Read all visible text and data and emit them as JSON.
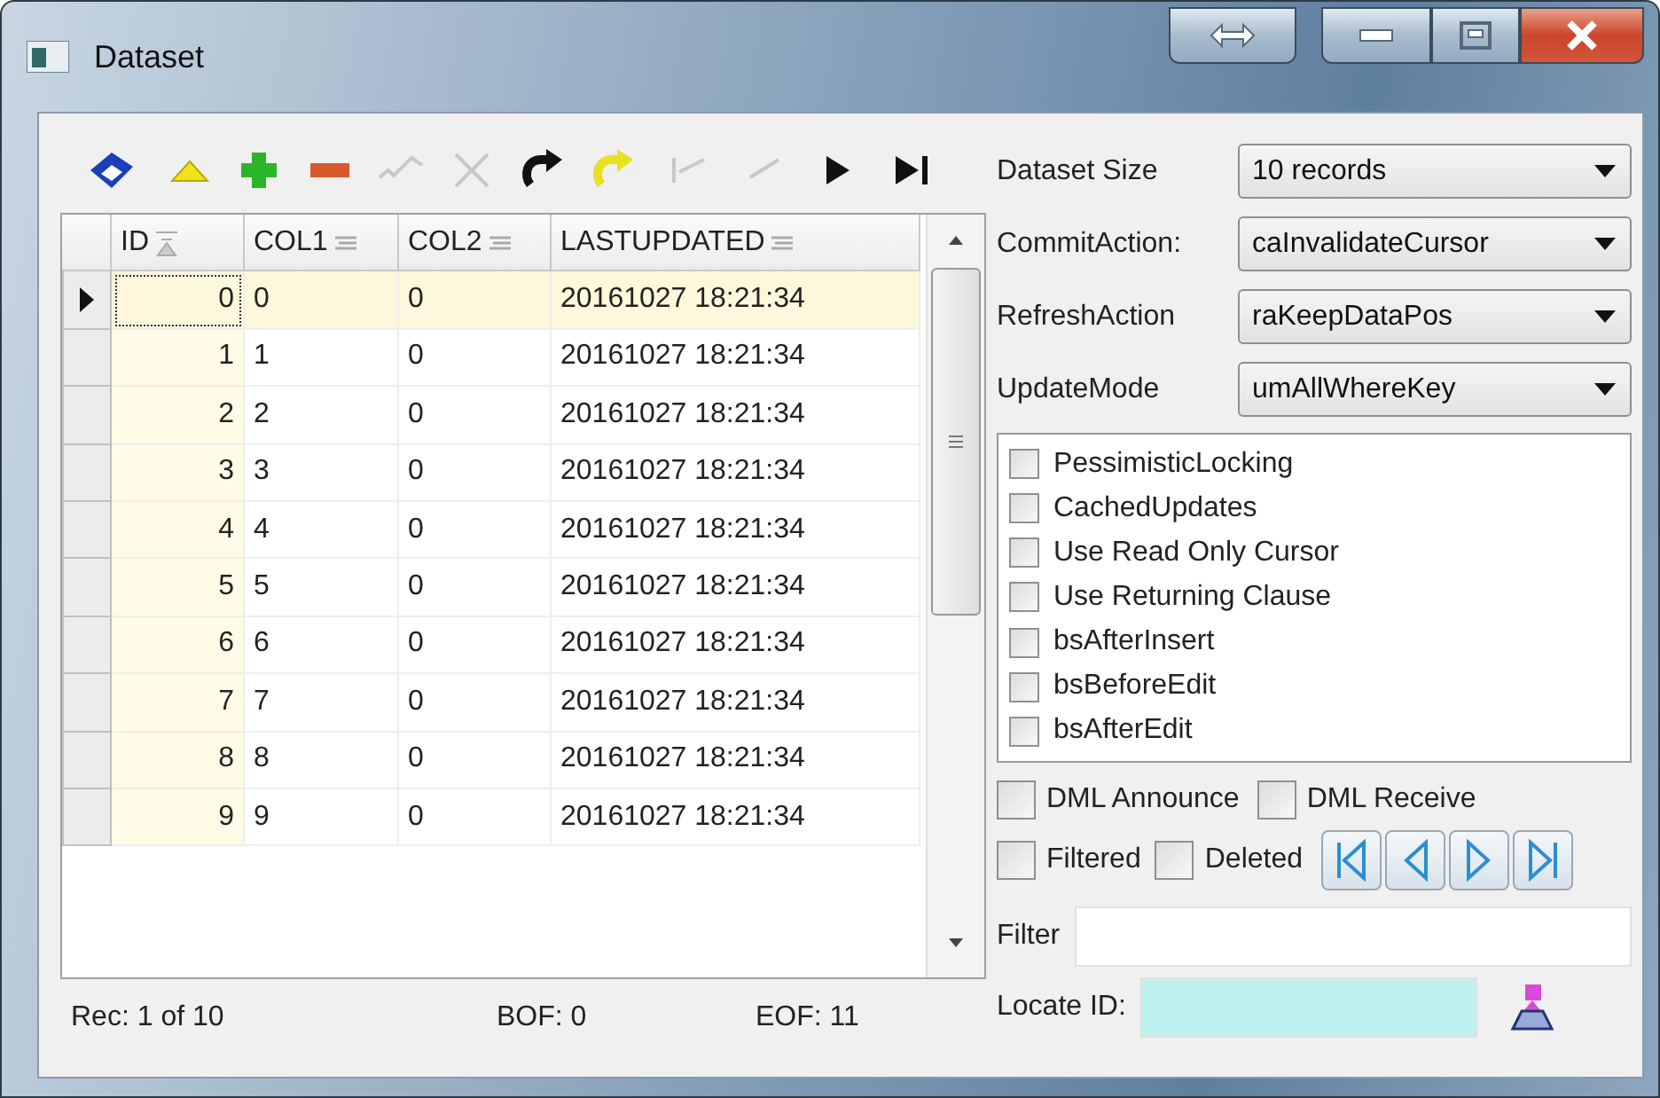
{
  "window": {
    "title": "Dataset"
  },
  "toolbar": [
    {
      "kind": "edit",
      "disabled": false
    },
    {
      "kind": "up",
      "disabled": false
    },
    {
      "kind": "insert",
      "disabled": false
    },
    {
      "kind": "delete",
      "disabled": false
    },
    {
      "kind": "post",
      "disabled": true
    },
    {
      "kind": "cancel",
      "disabled": true
    },
    {
      "kind": "refresh",
      "disabled": false
    },
    {
      "kind": "refresh_current",
      "disabled": false
    },
    {
      "kind": "first",
      "disabled": true
    },
    {
      "kind": "prior",
      "disabled": true
    },
    {
      "kind": "next",
      "disabled": false
    },
    {
      "kind": "last",
      "disabled": false
    }
  ],
  "grid": {
    "columns": [
      {
        "label": "ID",
        "sorted": true
      },
      {
        "label": "COL1",
        "sorted": false
      },
      {
        "label": "COL2",
        "sorted": false
      },
      {
        "label": "LASTUPDATED",
        "sorted": false
      }
    ],
    "rows": [
      {
        "cells": [
          "0",
          "0",
          "0",
          "20161027 18:21:34"
        ],
        "selected": true
      },
      {
        "cells": [
          "1",
          "1",
          "0",
          "20161027 18:21:34"
        ],
        "selected": false
      },
      {
        "cells": [
          "2",
          "2",
          "0",
          "20161027 18:21:34"
        ],
        "selected": false
      },
      {
        "cells": [
          "3",
          "3",
          "0",
          "20161027 18:21:34"
        ],
        "selected": false
      },
      {
        "cells": [
          "4",
          "4",
          "0",
          "20161027 18:21:34"
        ],
        "selected": false
      },
      {
        "cells": [
          "5",
          "5",
          "0",
          "20161027 18:21:34"
        ],
        "selected": false
      },
      {
        "cells": [
          "6",
          "6",
          "0",
          "20161027 18:21:34"
        ],
        "selected": false
      },
      {
        "cells": [
          "7",
          "7",
          "0",
          "20161027 18:21:34"
        ],
        "selected": false
      },
      {
        "cells": [
          "8",
          "8",
          "0",
          "20161027 18:21:34"
        ],
        "selected": false
      },
      {
        "cells": [
          "9",
          "9",
          "0",
          "20161027 18:21:34"
        ],
        "selected": false
      }
    ]
  },
  "status_bar": {
    "record": "Rec: 1 of 10",
    "bof": "BOF: 0",
    "eof": "EOF: 11"
  },
  "settings": [
    {
      "label": "Dataset Size",
      "value": "10 records"
    },
    {
      "label": "CommitAction:",
      "value": "caInvalidateCursor"
    },
    {
      "label": "RefreshAction",
      "value": "raKeepDataPos"
    },
    {
      "label": "UpdateMode",
      "value": "umAllWhereKey"
    }
  ],
  "options": [
    {
      "label": "PessimisticLocking",
      "checked": false
    },
    {
      "label": "CachedUpdates",
      "checked": false
    },
    {
      "label": "Use Read Only Cursor",
      "checked": false
    },
    {
      "label": "Use Returning Clause",
      "checked": false
    },
    {
      "label": "bsAfterInsert",
      "checked": false
    },
    {
      "label": "bsBeforeEdit",
      "checked": false
    },
    {
      "label": "bsAfterEdit",
      "checked": false
    }
  ],
  "dml": [
    {
      "label": "DML Announce",
      "checked": false
    },
    {
      "label": "DML Receive",
      "checked": false
    }
  ],
  "flags": [
    {
      "label": "Filtered",
      "checked": false
    },
    {
      "label": "Deleted",
      "checked": false
    }
  ],
  "navigator": [
    {
      "kind": "first"
    },
    {
      "kind": "prior"
    },
    {
      "kind": "next"
    },
    {
      "kind": "last"
    }
  ],
  "filter": {
    "label": "Filter"
  },
  "locate": {
    "label": "Locate ID:"
  }
}
